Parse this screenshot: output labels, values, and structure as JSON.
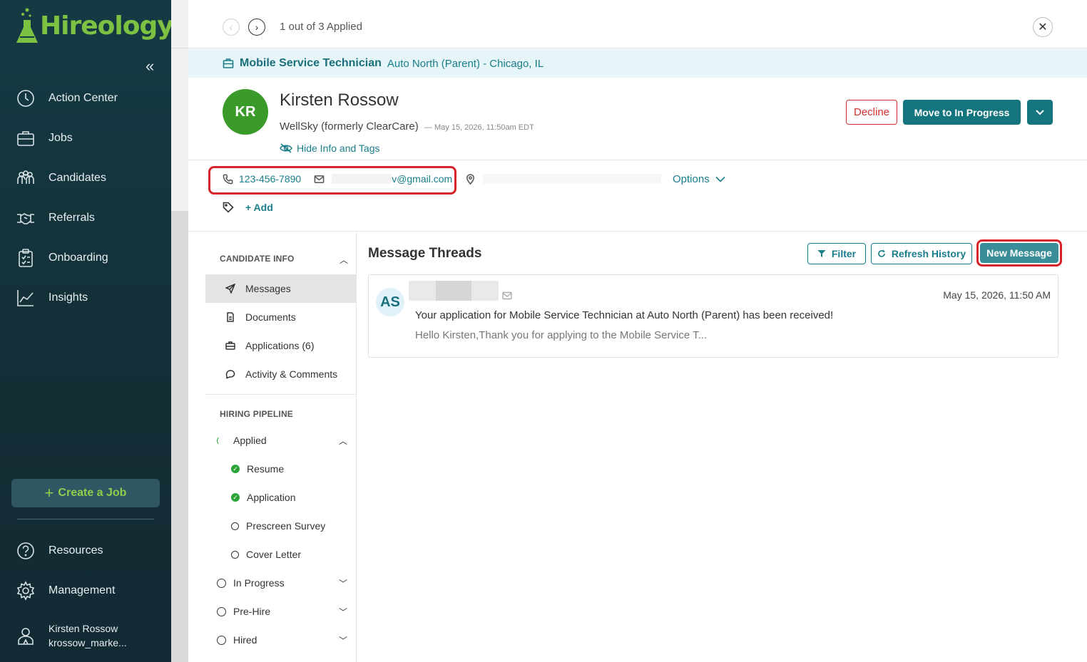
{
  "app": {
    "brand": "Hireology",
    "brand_color": "#7dc142",
    "sidebar_bg": "#153a44",
    "accent": "#15757f"
  },
  "sidebar": {
    "collapse_icon": "double-chevron-left",
    "items": [
      {
        "label": "Action Center",
        "icon": "clock-icon"
      },
      {
        "label": "Jobs",
        "icon": "briefcase-icon"
      },
      {
        "label": "Candidates",
        "icon": "people-icon"
      },
      {
        "label": "Referrals",
        "icon": "handshake-icon"
      },
      {
        "label": "Onboarding",
        "icon": "clipboard-icon"
      },
      {
        "label": "Insights",
        "icon": "chart-icon"
      }
    ],
    "create_job": "Create a Job",
    "bottom_items": [
      {
        "label": "Resources",
        "icon": "question-icon"
      },
      {
        "label": "Management",
        "icon": "gear-icon"
      }
    ],
    "user": {
      "name": "Kirsten Rossow",
      "handle": "krossow_marke..."
    }
  },
  "topbar": {
    "pager": "1 out of 3 Applied"
  },
  "job": {
    "title": "Mobile Service Technician",
    "location": "Auto North (Parent) - Chicago, IL"
  },
  "candidate": {
    "initials": "KR",
    "name": "Kirsten Rossow",
    "company": "WellSky (formerly ClearCare)",
    "timestamp": "— May 15, 2026, 11:50am EDT",
    "hide_info": "Hide Info and Tags",
    "phone": "123-456-7890",
    "email_visible": "v@gmail.com",
    "options": "Options",
    "add_tag": "Add"
  },
  "actions": {
    "decline": "Decline",
    "move": "Move to In Progress"
  },
  "left_panel": {
    "candidate_info_header": "CANDIDATE INFO",
    "items": [
      {
        "label": "Messages",
        "icon": "send-icon"
      },
      {
        "label": "Documents",
        "icon": "document-icon"
      },
      {
        "label": "Applications (6)",
        "icon": "briefcase-icon"
      },
      {
        "label": "Activity & Comments",
        "icon": "comment-icon"
      }
    ],
    "pipeline_header": "HIRING PIPELINE",
    "pipeline": {
      "applied": "Applied",
      "steps": [
        "Resume",
        "Application",
        "Prescreen Survey",
        "Cover Letter"
      ],
      "stages": [
        "In Progress",
        "Pre-Hire",
        "Hired"
      ]
    }
  },
  "threads": {
    "title": "Message Threads",
    "filter": "Filter",
    "refresh": "Refresh History",
    "new_message": "New Message",
    "items": [
      {
        "initials": "AS",
        "date": "May 15, 2026, 11:50 AM",
        "subject": "Your application for Mobile Service Technician at Auto North (Parent) has been received!",
        "preview": "Hello Kirsten,Thank you for applying to the Mobile Service T..."
      }
    ]
  }
}
